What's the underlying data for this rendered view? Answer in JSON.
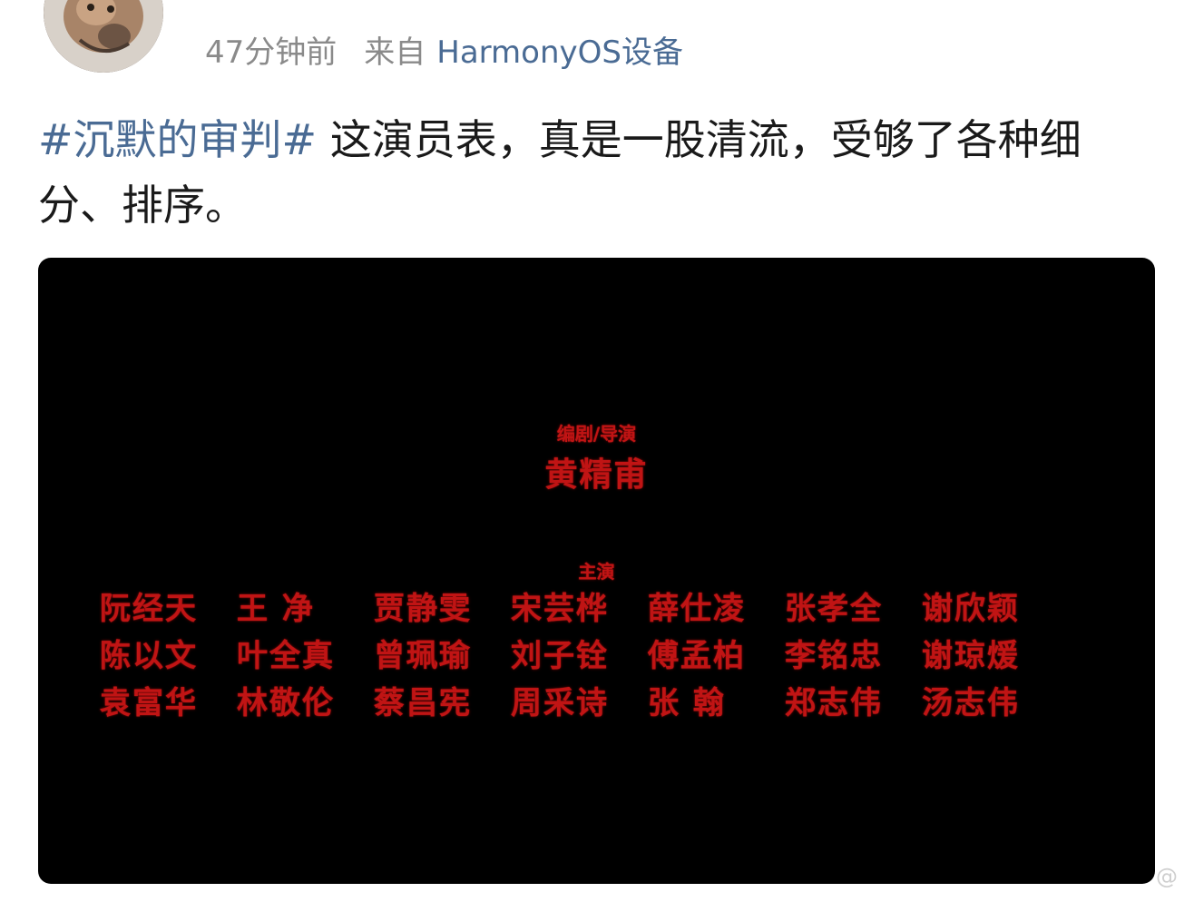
{
  "author": {
    "name": "",
    "avatar_icon": "cat-avatar-icon"
  },
  "meta": {
    "time": "47分钟前",
    "from_label": "来自",
    "device": "HarmonyOS设备"
  },
  "post": {
    "hashtag": "#沉默的审判#",
    "text": " 这演员表，真是一股清流，受够了各种细分、排序。"
  },
  "image": {
    "director_role": "编剧/导演",
    "director_name": "黄精甫",
    "cast_role": "主演",
    "cast": [
      [
        "阮经天",
        "王 净",
        "贾静雯",
        "宋芸桦",
        "薛仕凌",
        "张孝全",
        "谢欣颖"
      ],
      [
        "陈以文",
        "叶全真",
        "曾珮瑜",
        "刘子铨",
        "傅孟柏",
        "李铭忠",
        "谢琼煖"
      ],
      [
        "袁富华",
        "林敬伦",
        "蔡昌宪",
        "周采诗",
        "张 翰",
        "郑志伟",
        "汤志伟"
      ]
    ]
  },
  "watermark": "@",
  "colors": {
    "link": "#4a6b94",
    "credit_red": "#c01414"
  }
}
